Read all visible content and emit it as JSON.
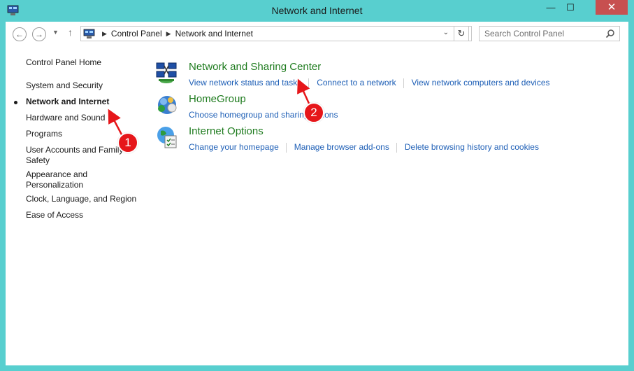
{
  "window": {
    "title": "Network and Internet",
    "controls": {
      "minimize": "—",
      "maximize": "☐",
      "close": "✕"
    }
  },
  "addressbar": {
    "breadcrumb": [
      "Control Panel",
      "Network and Internet"
    ],
    "search_placeholder": "Search Control Panel"
  },
  "sidebar": {
    "items": [
      {
        "label": "Control Panel Home"
      },
      {
        "label": "System and Security"
      },
      {
        "label": "Network and Internet",
        "active": true
      },
      {
        "label": "Hardware and Sound"
      },
      {
        "label": "Programs"
      },
      {
        "label": "User Accounts and Family Safety"
      },
      {
        "label": "Appearance and Personalization"
      },
      {
        "label": "Clock, Language, and Region"
      },
      {
        "label": "Ease of Access"
      }
    ]
  },
  "categories": [
    {
      "title": "Network and Sharing Center",
      "icon": "network-sharing-icon",
      "links": [
        "View network status and tasks",
        "Connect to a network",
        "View network computers and devices"
      ]
    },
    {
      "title": "HomeGroup",
      "icon": "homegroup-icon",
      "links": [
        "Choose homegroup and sharing options"
      ]
    },
    {
      "title": "Internet Options",
      "icon": "internet-options-icon",
      "links": [
        "Change your homepage",
        "Manage browser add-ons",
        "Delete browsing history and cookies"
      ]
    }
  ],
  "annotations": [
    "1",
    "2"
  ],
  "colors": {
    "frame": "#58cfcf",
    "link_blue": "#1e5fb6",
    "category_green": "#1e7b1e",
    "annotation_red": "#e6161a"
  }
}
